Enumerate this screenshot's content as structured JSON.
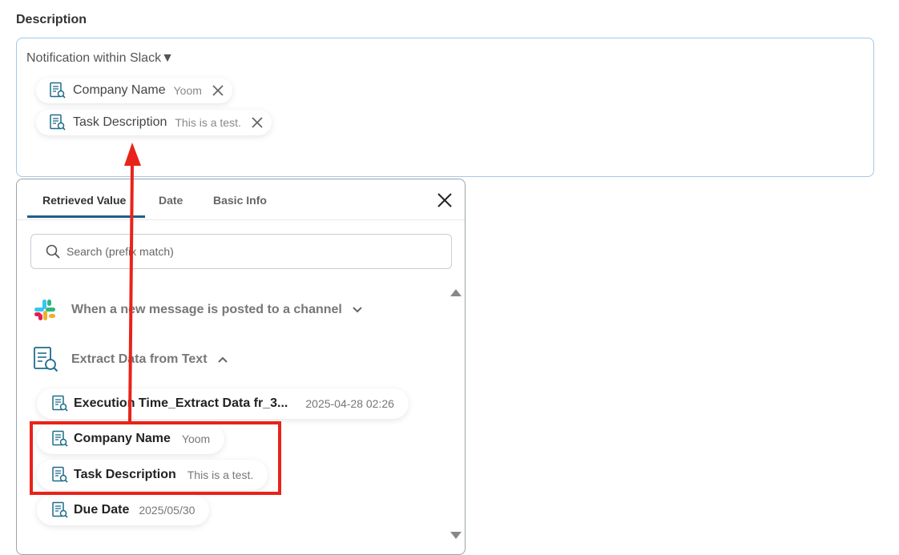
{
  "section": {
    "label": "Description"
  },
  "description": {
    "text": "Notification within Slack▼",
    "chips": [
      {
        "name": "Company Name",
        "value": "Yoom"
      },
      {
        "name": "Task Description",
        "value": "This is a test."
      }
    ]
  },
  "panel": {
    "tabs": [
      {
        "label": "Retrieved Value"
      },
      {
        "label": "Date"
      },
      {
        "label": "Basic Info"
      }
    ],
    "search": {
      "placeholder": "Search (prefix match)"
    },
    "groups": [
      {
        "label": "When a new message is posted to a channel",
        "icon": "slack-icon",
        "expanded": false
      },
      {
        "label": "Extract Data from Text",
        "icon": "document-search-icon",
        "expanded": true
      }
    ],
    "items": [
      {
        "name": "Execution Time_Extract Data fr_3...",
        "value": "2025-04-28 02:26"
      },
      {
        "name": "Company Name",
        "value": "Yoom"
      },
      {
        "name": "Task Description",
        "value": "This is a test."
      },
      {
        "name": "Due Date",
        "value": "2025/05/30"
      }
    ]
  },
  "colors": {
    "accent": "#1f5f8b",
    "highlight": "#e8231a",
    "icon": "#1e6c8c",
    "box_border": "#a6c8e6"
  }
}
